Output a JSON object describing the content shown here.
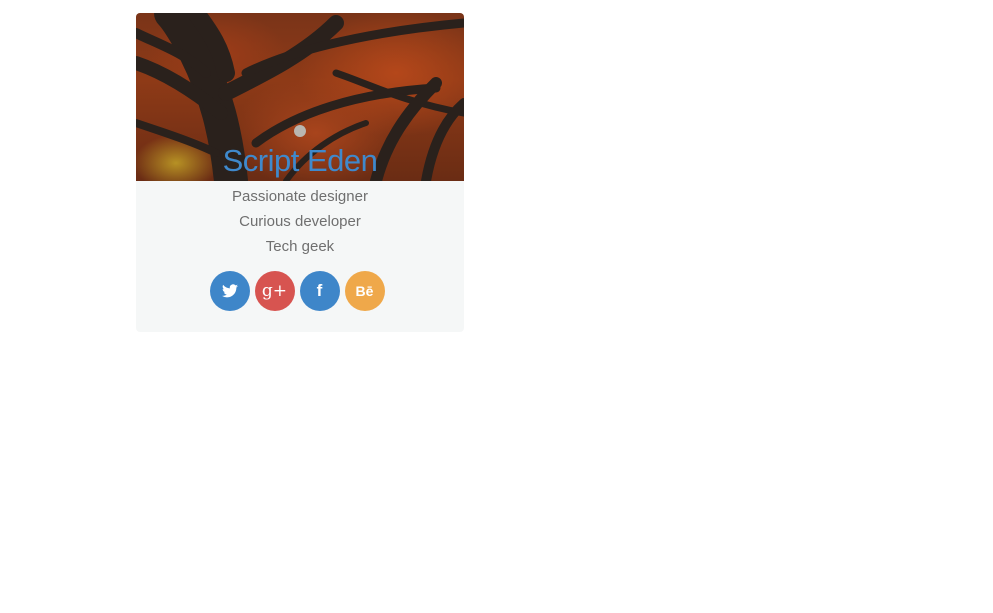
{
  "profile": {
    "name": "Script Eden",
    "cover_image": "autumn-tree-canopy",
    "bio_lines": [
      "Passionate designer",
      "Curious developer",
      "Tech geek"
    ]
  },
  "social": [
    {
      "name": "twitter",
      "glyph": "🐦",
      "label": "Twitter",
      "color": "#3e86c9"
    },
    {
      "name": "google-plus",
      "glyph": "g+",
      "label": "Google Plus",
      "color": "#d75450"
    },
    {
      "name": "facebook",
      "glyph": "f",
      "label": "Facebook",
      "color": "#3e86c9"
    },
    {
      "name": "behance",
      "glyph": "Bē",
      "label": "Behance",
      "color": "#efa84a"
    }
  ]
}
